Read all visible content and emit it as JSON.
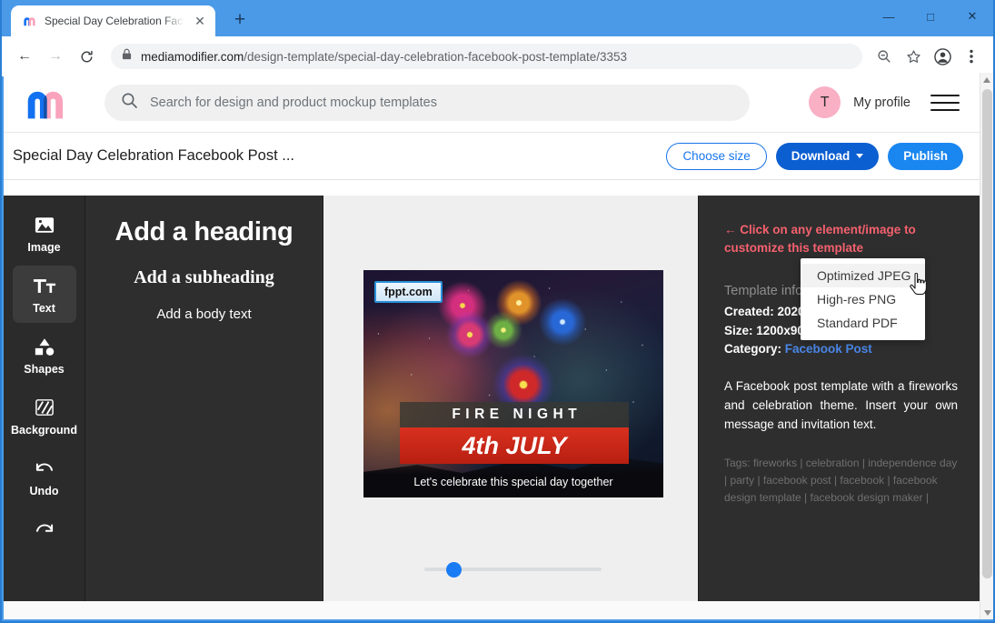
{
  "browser": {
    "tab": {
      "title": "Special Day Celebration Faceboo",
      "favicon": "mediamodifier-m-icon",
      "close_label": "✕"
    },
    "new_tab_label": "+",
    "window_controls": {
      "minimize": "—",
      "maximize": "□",
      "close": "✕"
    },
    "nav": {
      "back": "←",
      "forward": "→",
      "reload": "↻"
    },
    "omnibox": {
      "lock_icon": "lock-icon",
      "url_domain": "mediamodifier.com",
      "url_path": "/design-template/special-day-celebration-facebook-post-template/3353"
    },
    "toolbar_icons": [
      "zoom-out-icon",
      "bookmark-star-icon",
      "browser-profile-icon",
      "browser-menu-icon"
    ]
  },
  "app_header": {
    "logo_name": "mediamodifier-logo",
    "logo_colors": {
      "left": "#1271f0",
      "right": "#f9a3bd",
      "mid": "#0f4fa8"
    },
    "search": {
      "placeholder": "Search for design and product mockup templates",
      "icon": "search-icon"
    },
    "avatar_initial": "T",
    "avatar_color": "#f9afc4",
    "profile_label": "My profile",
    "menu_icon": "hamburger-menu-icon"
  },
  "editor_bar": {
    "document_title": "Special Day Celebration Facebook Post ...",
    "choose_size_label": "Choose size",
    "download_label": "Download",
    "publish_label": "Publish",
    "accent_blue": "#1a73e8",
    "download_bg": "#0c5fd1",
    "publish_bg": "#1a86f0"
  },
  "download_menu": {
    "items": [
      {
        "label": "Optimized JPEG",
        "hovered": true
      },
      {
        "label": "High-res PNG",
        "hovered": false
      },
      {
        "label": "Standard PDF",
        "hovered": false
      }
    ]
  },
  "tool_sidebar": {
    "items": [
      {
        "label": "Image",
        "icon": "image-icon",
        "active": false
      },
      {
        "label": "Text",
        "icon": "text-tt-icon",
        "active": true
      },
      {
        "label": "Shapes",
        "icon": "shapes-icon",
        "active": false
      },
      {
        "label": "Background",
        "icon": "background-hatch-icon",
        "active": false
      },
      {
        "label": "Undo",
        "icon": "undo-arrow-icon",
        "active": false
      },
      {
        "label": "",
        "icon": "redo-arrow-icon",
        "active": false
      }
    ]
  },
  "text_panel": {
    "heading": "Add a heading",
    "subheading": "Add a subheading",
    "body": "Add a body text"
  },
  "canvas": {
    "preview": {
      "watermark": "fppt.com",
      "title_band": "FIRE NIGHT",
      "date_band": "4th JULY",
      "tagline": "Let's celebrate this special day together"
    },
    "zoom_slider": {
      "value": 12,
      "min": 0,
      "max": 100
    }
  },
  "info_panel": {
    "hint": "← Click on any element/image to customize this template",
    "section_title": "Template info",
    "created_label": "Created:",
    "created_value": "2020-01-22",
    "size_label": "Size:",
    "size_value": "1200x900px",
    "category_label": "Category:",
    "category_value": "Facebook Post",
    "description": "A Facebook post template with a fireworks and celebration theme. Insert your own message and invitation text.",
    "tags": "Tags: fireworks | celebration | independence day | party | facebook post | facebook | facebook design template | facebook design maker |"
  }
}
